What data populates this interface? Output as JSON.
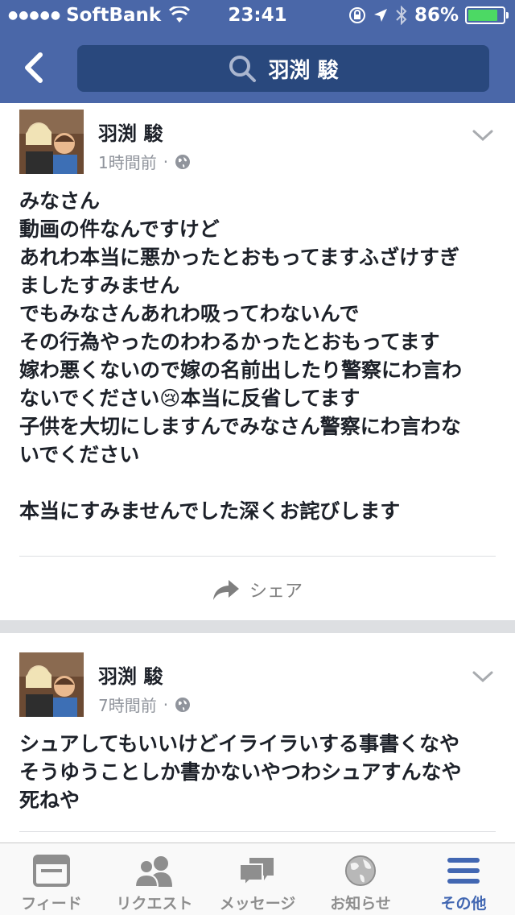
{
  "status_bar": {
    "carrier": "SoftBank",
    "time": "23:41",
    "battery": "86%",
    "battery_level": 0.86
  },
  "header": {
    "search_text": "羽渕 駿"
  },
  "posts": [
    {
      "author": "羽渕 駿",
      "time": "1時間前",
      "lines": [
        "みなさん",
        "動画の件なんですけど",
        "あれわ本当に悪かったとおもってますふざけすぎ",
        "ましたすみません",
        "でもみなさんあれわ吸ってわないんで",
        "その行為やったのわわるかったとおもってます",
        "嫁わ悪くないので嫁の名前出したり警察にわ言わ",
        "ないでください😢本当に反省してます",
        "子供を大切にしますんでみなさん警察にわ言わな",
        "いでください",
        "",
        "本当にすみませんでした深くお詫びします"
      ],
      "share_label": "シェア"
    },
    {
      "author": "羽渕 駿",
      "time": "7時間前",
      "lines": [
        "シュアしてもいいけどイライラいする事書くなや",
        "そうゆうことしか書かないやつわシュアすんなや",
        "死ねや"
      ]
    }
  ],
  "tabbar": {
    "tabs": [
      {
        "label": "フィード",
        "icon": "feed-icon"
      },
      {
        "label": "リクエスト",
        "icon": "friend-requests-icon"
      },
      {
        "label": "メッセージ",
        "icon": "messages-icon"
      },
      {
        "label": "お知らせ",
        "icon": "globe-icon"
      },
      {
        "label": "その他",
        "icon": "menu-icon"
      }
    ],
    "active": "その他"
  },
  "colors": {
    "header": "#4a67a8",
    "search_box": "#29487d",
    "active_tab": "#4267b2",
    "battery": "#4cd964"
  }
}
